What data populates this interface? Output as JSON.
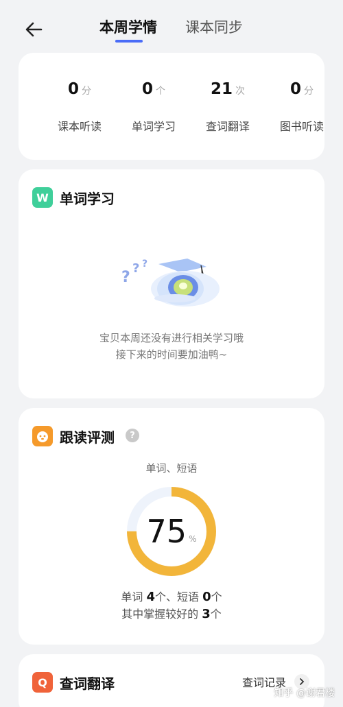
{
  "header": {
    "tabs": [
      {
        "label": "本周学情",
        "active": true
      },
      {
        "label": "课本同步",
        "active": false
      }
    ],
    "accent_color": "#4a6cf7"
  },
  "stats": [
    {
      "value": "0",
      "unit": "分",
      "label": "课本听读"
    },
    {
      "value": "0",
      "unit": "个",
      "label": "单词学习"
    },
    {
      "value": "21",
      "unit": "次",
      "label": "查词翻译"
    },
    {
      "value": "0",
      "unit": "分",
      "label": "图书听读"
    }
  ],
  "word_study": {
    "icon": "W",
    "icon_color": "#3fcf9a",
    "title": "单词学习",
    "empty_line1": "宝贝本周还没有进行相关学习哦",
    "empty_line2": "接下来的时间要加油鸭~"
  },
  "reading": {
    "icon_name": "puppy-face-icon",
    "icon_color": "#f59a2b",
    "title": "跟读评测",
    "help": "?",
    "caption": "单词、短语",
    "score": "75",
    "score_unit": "%",
    "score_fraction": 0.75,
    "ring_color": "#f2b53a",
    "line1": {
      "a": "单词 ",
      "n1": "4",
      "b": "个、短语 ",
      "n2": "0",
      "c": "个"
    },
    "line2": {
      "a": "其中掌握较好的 ",
      "n": "3",
      "b": "个"
    }
  },
  "lookup": {
    "icon": "Q",
    "icon_color": "#f0633a",
    "title": "查词翻译",
    "record": "查词记录"
  },
  "watermark": "知乎 @谢君楼"
}
